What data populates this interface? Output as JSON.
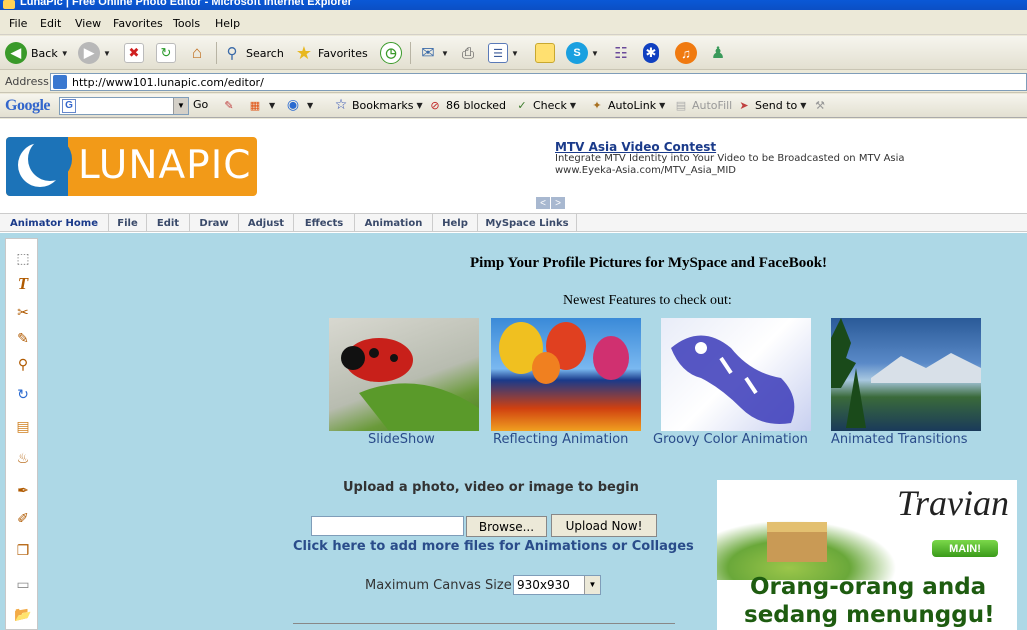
{
  "window": {
    "title": "LunaPic | Free Online Photo Editor - Microsoft Internet Explorer"
  },
  "menu": [
    "File",
    "Edit",
    "View",
    "Favorites",
    "Tools",
    "Help"
  ],
  "toolbar": {
    "back": "Back",
    "search": "Search",
    "favorites": "Favorites"
  },
  "address": {
    "label": "Address",
    "url": "http://www101.lunapic.com/editor/"
  },
  "google_bar": {
    "logo": "Google",
    "go": "Go",
    "bookmarks": "Bookmarks",
    "blocked": "86 blocked",
    "check": "Check",
    "autolink": "AutoLink",
    "autofill": "AutoFill",
    "send_to": "Send to"
  },
  "site": {
    "logo": "LUNAPIC",
    "ad": {
      "title": "MTV Asia Video Contest",
      "line1": "Integrate MTV Identity into Your Video to be Broadcasted on MTV Asia",
      "line2": "www.Eyeka-Asia.com/MTV_Asia_MID"
    },
    "nav": [
      "Animator Home",
      "File",
      "Edit",
      "Draw",
      "Adjust",
      "Effects",
      "Animation",
      "Help",
      "MySpace Links"
    ],
    "heading": "Pimp Your Profile Pictures for MySpace and FaceBook!",
    "newest": "Newest Features to check out:",
    "features": [
      {
        "caption": "SlideShow"
      },
      {
        "caption": "Reflecting Animation"
      },
      {
        "caption": "Groovy Color Animation"
      },
      {
        "caption": "Animated Transitions"
      }
    ],
    "upload": {
      "title": "Upload a photo, video or image to begin",
      "browse": "Browse...",
      "upload_now": "Upload Now!",
      "more_files": "Click here to add more files for Animations or Collages",
      "canvas_label": "Maximum Canvas Size:",
      "canvas_value": "930x930"
    },
    "travian_ad": {
      "logo": "Travian",
      "main_button": "MAIN!",
      "line1": "Orang-orang anda",
      "line2": "sedang menunggu!"
    }
  }
}
